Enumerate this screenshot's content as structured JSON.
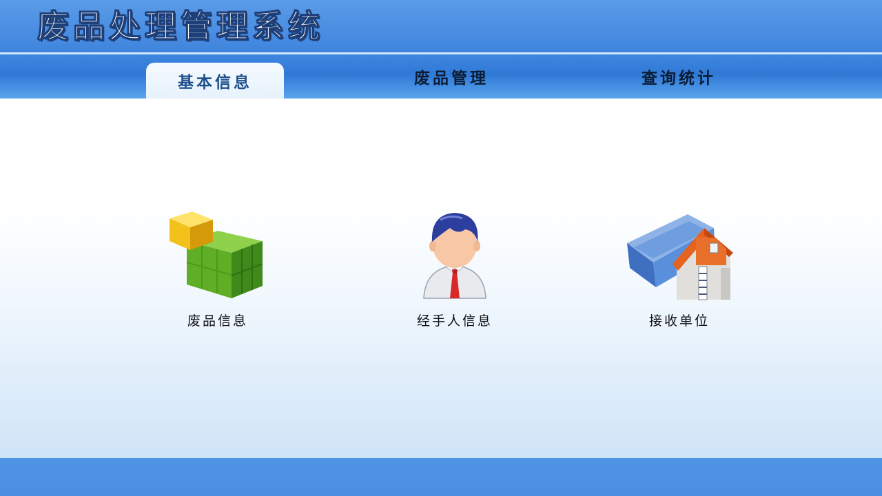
{
  "app": {
    "title": "废品处理管理系统"
  },
  "tabs": [
    {
      "label": "基本信息",
      "active": true
    },
    {
      "label": "废品管理",
      "active": false
    },
    {
      "label": "查询统计",
      "active": false
    }
  ],
  "modules": [
    {
      "label": "废品信息",
      "icon": "blocks-icon"
    },
    {
      "label": "经手人信息",
      "icon": "person-icon"
    },
    {
      "label": "接收单位",
      "icon": "building-icon"
    }
  ],
  "colors": {
    "header_blue": "#4a8ee3",
    "tab_active_text": "#1d4f8c",
    "footer_blue": "#4f94e4"
  }
}
